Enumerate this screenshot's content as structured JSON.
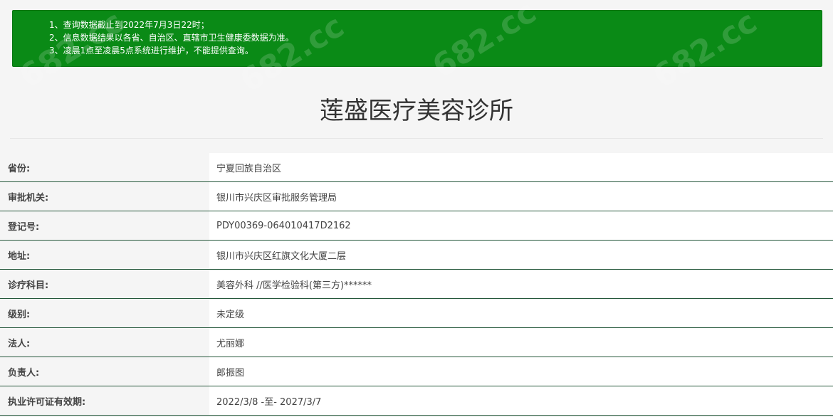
{
  "notice": {
    "lines": [
      "1、查询数据截止到2022年7月3日22时；",
      "2、信息数据结果以各省、自治区、直辖市卫生健康委数据为准。",
      "3、凌晨1点至凌晨5点系统进行维护，不能提供查询。"
    ]
  },
  "title": "莲盛医疗美容诊所",
  "rows": [
    {
      "label": "省份:",
      "value": "宁夏回族自治区"
    },
    {
      "label": "审批机关:",
      "value": "银川市兴庆区审批服务管理局"
    },
    {
      "label": "登记号:",
      "value": "PDY00369-064010417D2162"
    },
    {
      "label": "地址:",
      "value": "银川市兴庆区红旗文化大厦二层"
    },
    {
      "label": "诊疗科目:",
      "value": "美容外科 //医学检验科(第三方)******"
    },
    {
      "label": "级别:",
      "value": "未定级"
    },
    {
      "label": "法人:",
      "value": "尤丽娜"
    },
    {
      "label": "负责人:",
      "value": "郎振图"
    },
    {
      "label": "执业许可证有效期:",
      "value": "2022/3/8 -至- 2027/3/7"
    }
  ],
  "watermark": "682.cc",
  "colors": {
    "notice_bg": "#0a8a16",
    "row_border": "#24573a"
  }
}
